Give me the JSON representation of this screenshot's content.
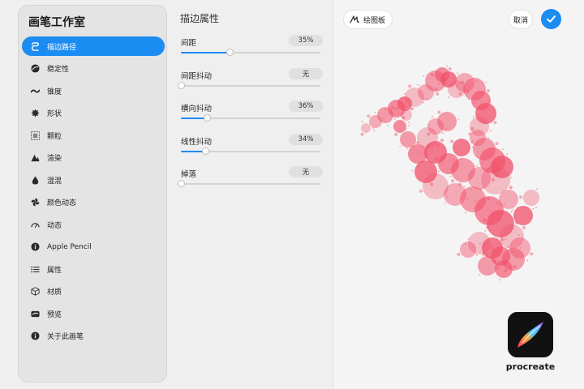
{
  "sidebar": {
    "title": "画笔工作室",
    "items": [
      {
        "label": "描边路径",
        "icon": "stroke-path-icon",
        "active": true
      },
      {
        "label": "稳定性",
        "icon": "stabilization-icon"
      },
      {
        "label": "锥度",
        "icon": "taper-icon"
      },
      {
        "label": "形状",
        "icon": "shape-icon"
      },
      {
        "label": "颗粒",
        "icon": "grain-icon"
      },
      {
        "label": "渲染",
        "icon": "rendering-icon"
      },
      {
        "label": "湿混",
        "icon": "wet-mix-icon"
      },
      {
        "label": "颜色动态",
        "icon": "color-dynamics-icon"
      },
      {
        "label": "动态",
        "icon": "dynamics-icon"
      },
      {
        "label": "Apple Pencil",
        "icon": "info-icon"
      },
      {
        "label": "属性",
        "icon": "properties-icon"
      },
      {
        "label": "材质",
        "icon": "material-icon"
      },
      {
        "label": "预览",
        "icon": "preview-icon"
      },
      {
        "label": "关于此画笔",
        "icon": "about-icon"
      }
    ]
  },
  "panel": {
    "title": "描边属性",
    "properties": [
      {
        "label": "间距",
        "value": "35%",
        "level": 0.35
      },
      {
        "label": "间距抖动",
        "value": "无",
        "level": 0
      },
      {
        "label": "横向抖动",
        "value": "36%",
        "level": 0.19
      },
      {
        "label": "线性抖动",
        "value": "34%",
        "level": 0.18
      },
      {
        "label": "掉落",
        "value": "无",
        "level": 0
      }
    ]
  },
  "preview": {
    "pad_label": "绘图板",
    "cancel_label": "取消",
    "app_name": "procreate"
  },
  "colors": {
    "accent": "#1b8cf2",
    "stroke": "#f2506a"
  }
}
